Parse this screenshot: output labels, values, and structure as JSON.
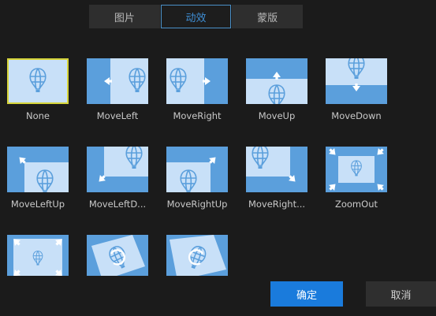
{
  "tabs": [
    {
      "label": "图片",
      "active": false
    },
    {
      "label": "动效",
      "active": true
    },
    {
      "label": "蒙版",
      "active": false
    }
  ],
  "effects": [
    {
      "label": "None",
      "icon": "none-icon",
      "selected": true
    },
    {
      "label": "MoveLeft",
      "icon": "move-left-icon"
    },
    {
      "label": "MoveRight",
      "icon": "move-right-icon"
    },
    {
      "label": "MoveUp",
      "icon": "move-up-icon"
    },
    {
      "label": "MoveDown",
      "icon": "move-down-icon"
    },
    {
      "label": "MoveLeftUp",
      "icon": "move-left-up-icon"
    },
    {
      "label": "MoveLeftD...",
      "icon": "move-left-down-icon"
    },
    {
      "label": "MoveRightUp",
      "icon": "move-right-up-icon"
    },
    {
      "label": "MoveRight...",
      "icon": "move-right-down-icon"
    },
    {
      "label": "ZoomOut",
      "icon": "zoom-out-icon"
    },
    {
      "label": "",
      "icon": "zoom-in-icon"
    },
    {
      "label": "",
      "icon": "rotate-left-icon"
    },
    {
      "label": "",
      "icon": "rotate-right-icon"
    }
  ],
  "buttons": {
    "ok": "确定",
    "cancel": "取消"
  },
  "colors": {
    "accent": "#1a7bdc",
    "selected_border": "#d6d43a",
    "thumb_blue": "#5b9fdc",
    "thumb_light": "#c8e0f8"
  }
}
